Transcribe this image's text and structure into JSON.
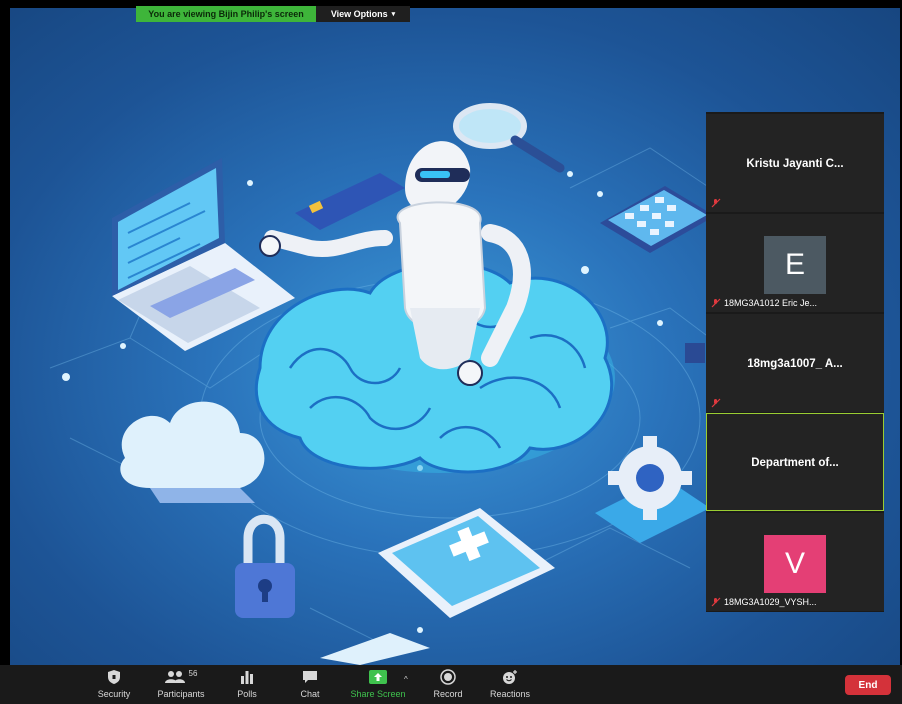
{
  "share_banner": {
    "viewing_text": "You are viewing Bijin Philip's screen",
    "view_options_label": "View Options",
    "view_options_icon": "chevron-down-icon"
  },
  "participants_panel": {
    "tiles": [
      {
        "name": "Kristu Jayanti C...",
        "has_avatar": false,
        "muted": true
      },
      {
        "name": "18MG3A1012 Eric Je...",
        "has_avatar": true,
        "avatar_letter": "E",
        "avatar_color": "#4c5962",
        "muted": true
      },
      {
        "name": "18mg3a1007_ A...",
        "has_avatar": false,
        "muted": true
      },
      {
        "name": "Department of...",
        "has_avatar": false,
        "active_speaker": true
      },
      {
        "name": "18MG3A1029_VYSH...",
        "has_avatar": true,
        "avatar_letter": "V",
        "avatar_color": "#e43f75",
        "muted": true
      }
    ]
  },
  "toolbar": {
    "security_label": "Security",
    "participants_label": "Participants",
    "participants_count": "56",
    "polls_label": "Polls",
    "chat_label": "Chat",
    "share_screen_label": "Share Screen",
    "record_label": "Record",
    "reactions_label": "Reactions",
    "end_label": "End"
  },
  "colors": {
    "share_green": "#3eb53a",
    "end_red": "#d4323a",
    "active_speaker_border": "#9acd32",
    "muted_red": "#e0393e"
  }
}
